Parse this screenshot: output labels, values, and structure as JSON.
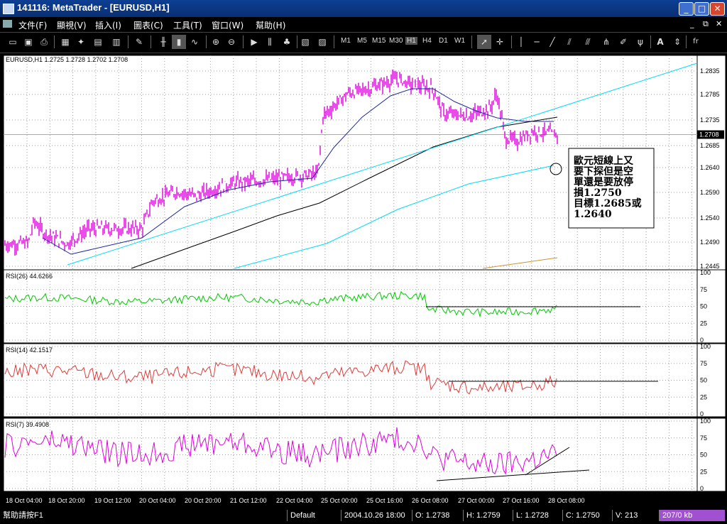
{
  "window": {
    "title": "141116: MetaTrader - [EURUSD,H1]",
    "buttons": [
      "_",
      "□",
      "✕"
    ]
  },
  "menu": {
    "items": [
      "文件(F)",
      "顯視(V)",
      "插入(I)",
      "圖表(C)",
      "工具(T)",
      "窗口(W)",
      "幫助(H)"
    ],
    "mdi_buttons": [
      "_",
      "⧉",
      "✕"
    ]
  },
  "toolbar": {
    "timeframes": [
      "M1",
      "M5",
      "M15",
      "M30",
      "H1",
      "H4",
      "D1",
      "W1"
    ],
    "selected_timeframe": "H1",
    "text_tool": "A",
    "fib_tool": "fr"
  },
  "chart": {
    "header": "EURUSD,H1  1.2725 1.2728 1.2702 1.2708",
    "price_ticks": [
      "1.2835",
      "1.2785",
      "1.2735",
      "1.2685",
      "1.2640",
      "1.2590",
      "1.2540",
      "1.2490",
      "1.2445"
    ],
    "current_price": "1.2708",
    "time_labels": [
      "18 Oct 04:00",
      "18 Oct 20:00",
      "19 Oct 12:00",
      "20 Oct 04:00",
      "20 Oct 20:00",
      "21 Oct 12:00",
      "22 Oct 04:00",
      "25 Oct 00:00",
      "25 Oct 16:00",
      "26 Oct 08:00",
      "27 Oct 00:00",
      "27 Oct 16:00",
      "28 Oct 08:00"
    ],
    "annotation": [
      "歐元短線上又",
      "要下探但是空",
      "單還是要放停",
      "損1.2750",
      "目標1.2685或",
      "1.2640"
    ],
    "indicators": [
      {
        "label": "RSI(26)  44.6266",
        "ticks": [
          "100",
          "75",
          "50",
          "25",
          "0"
        ],
        "color": "#00c800"
      },
      {
        "label": "RSI(14)  42.1517",
        "ticks": [
          "100",
          "75",
          "50",
          "25",
          "0"
        ],
        "color": "#e03c3c"
      },
      {
        "label": "RSI(7)  39.4908",
        "ticks": [
          "100",
          "75",
          "50",
          "25",
          "0"
        ],
        "color": "#e000e0"
      }
    ],
    "colors": {
      "candles": "#e000e0",
      "ma_fast": "#1e2a9e",
      "ma_slow": "#000000",
      "trendline": "#00d8ff",
      "grid": "#a0a0a0"
    }
  },
  "status": {
    "help": "幫助請按F1",
    "profile": "Default",
    "datetime": "2004.10.26 18:00",
    "open": "O: 1.2738",
    "high": "H: 1.2759",
    "low": "L: 1.2728",
    "close": "C: 1.2750",
    "volume": "V: 213",
    "traffic": "207/0 kb"
  }
}
